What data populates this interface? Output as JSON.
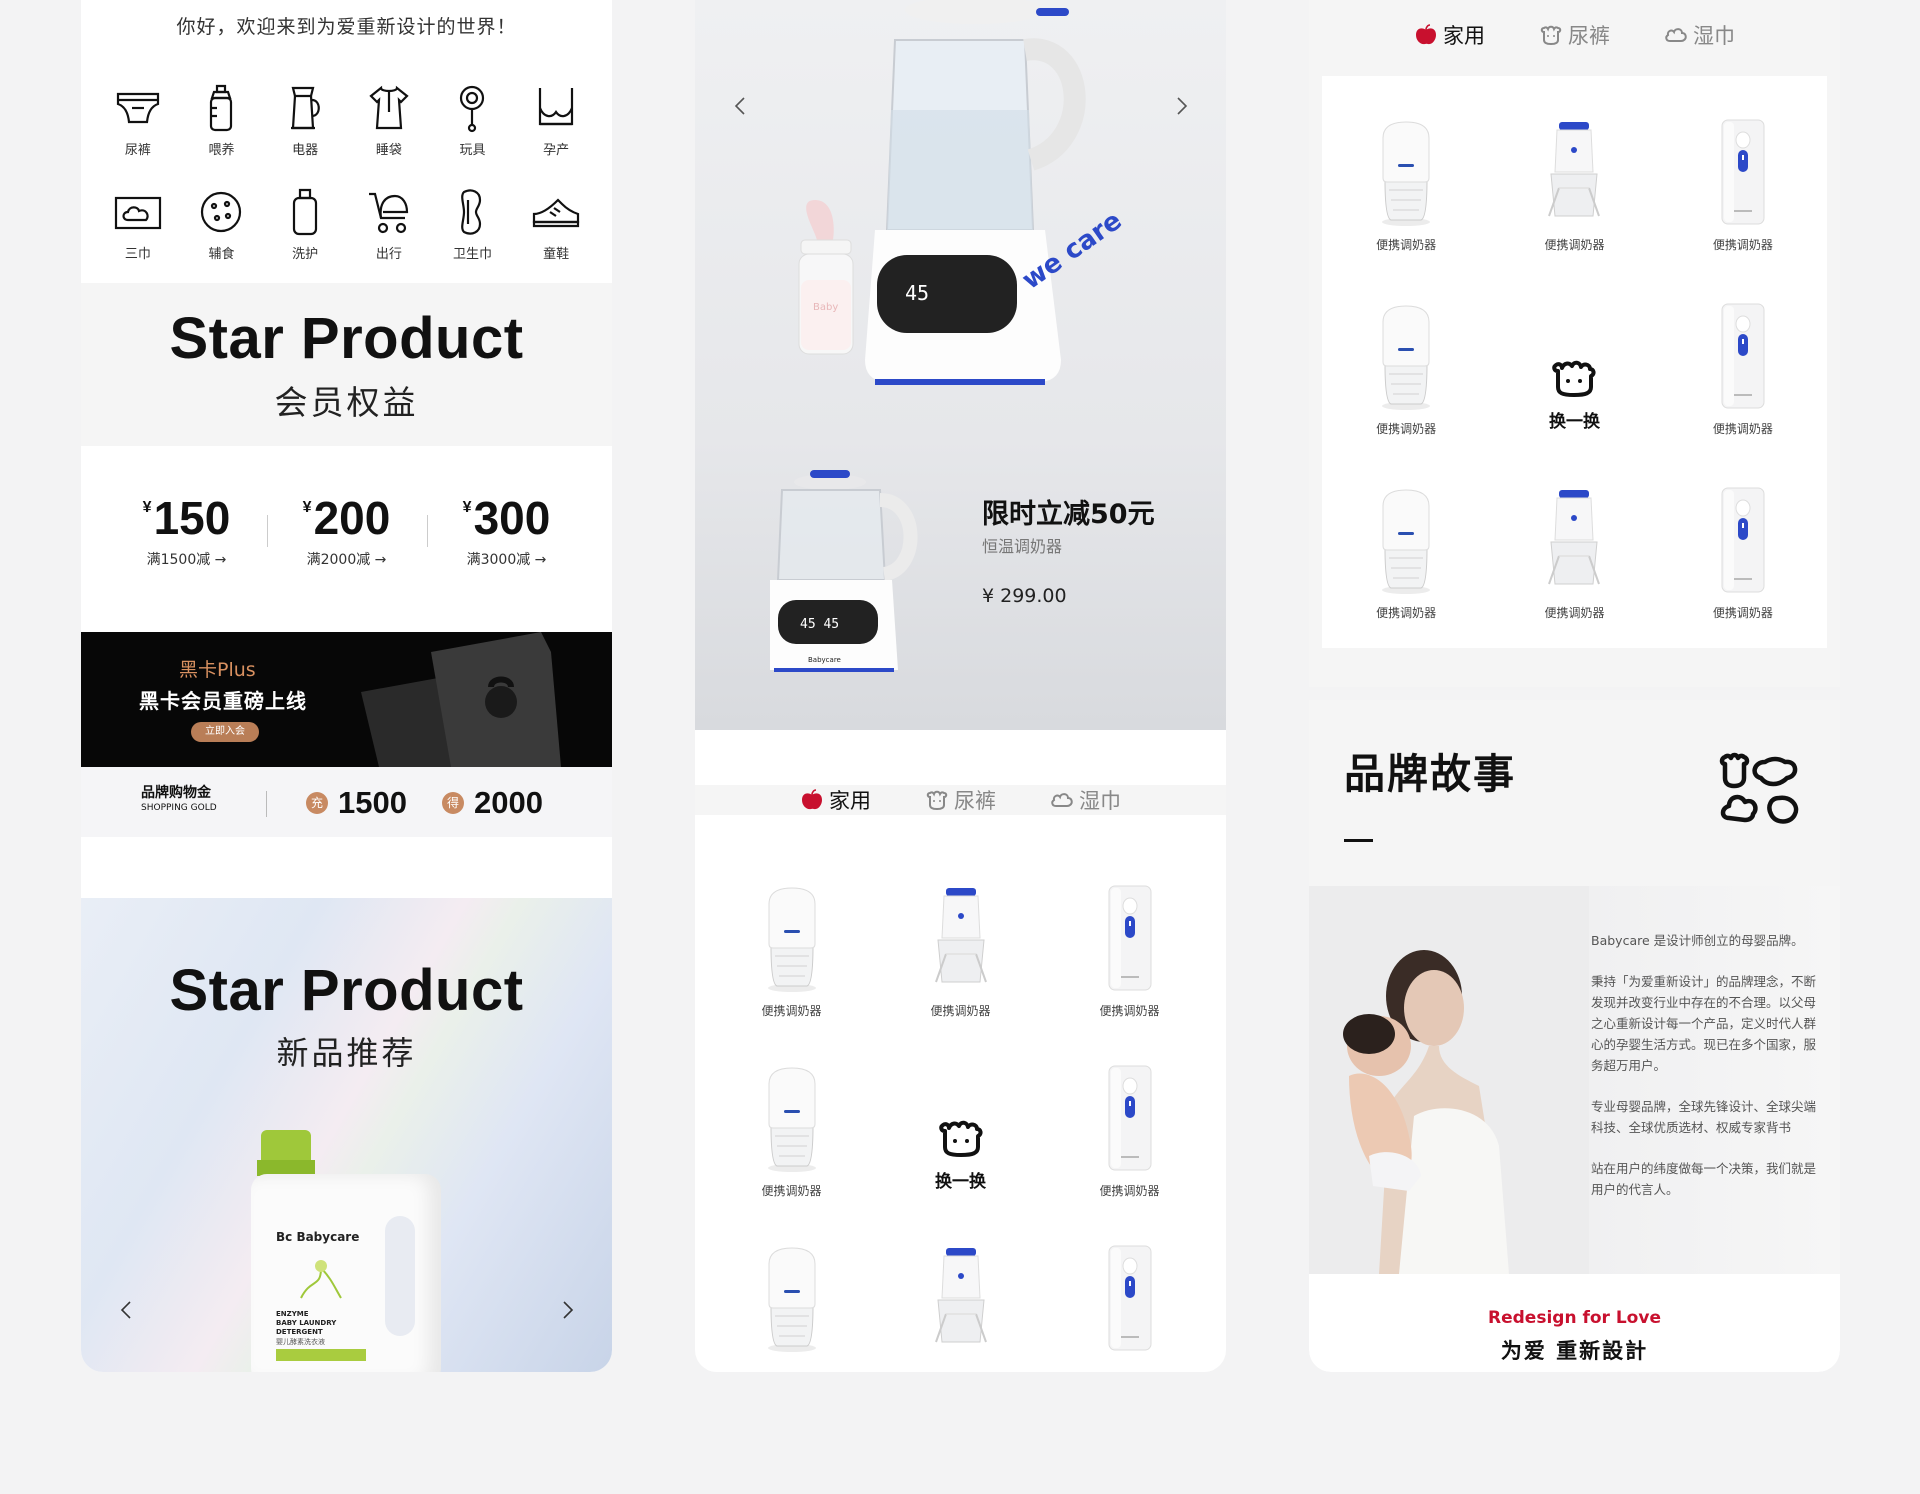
{
  "col1": {
    "greeting": "你好，欢迎来到为爱重新设计的世界！",
    "categories": [
      {
        "label": "尿裤",
        "icon": "diaper-icon"
      },
      {
        "label": "喂养",
        "icon": "baby-bottle-icon"
      },
      {
        "label": "电器",
        "icon": "kettle-icon"
      },
      {
        "label": "睡袋",
        "icon": "sleeping-bag-icon"
      },
      {
        "label": "玩具",
        "icon": "rattle-icon"
      },
      {
        "label": "孕产",
        "icon": "maternity-bra-icon"
      },
      {
        "label": "三巾",
        "icon": "towel-icon"
      },
      {
        "label": "辅食",
        "icon": "cookie-icon"
      },
      {
        "label": "洗护",
        "icon": "lotion-bottle-icon"
      },
      {
        "label": "出行",
        "icon": "stroller-icon"
      },
      {
        "label": "卫生巾",
        "icon": "sanitary-pad-icon"
      },
      {
        "label": "童鞋",
        "icon": "sneaker-icon"
      }
    ],
    "member": {
      "title": "Star Product",
      "subtitle": "会员权益"
    },
    "coupons": [
      {
        "currency": "¥",
        "amount": "150",
        "condition": "满1500减 →"
      },
      {
        "currency": "¥",
        "amount": "200",
        "condition": "满2000减 →"
      },
      {
        "currency": "¥",
        "amount": "300",
        "condition": "满3000减 →"
      }
    ],
    "black_card": {
      "tag": "黑卡Plus",
      "title": "黑卡会员重磅上线",
      "button": "立即入会"
    },
    "gold": {
      "label": "品牌购物金",
      "label_en": "SHOPPING GOLD",
      "charge_badge": "充",
      "charge": "1500",
      "get_badge": "得",
      "get": "2000"
    },
    "new_products": {
      "title": "Star Product",
      "subtitle": "新品推荐"
    },
    "detergent": {
      "brand": "Bc Babycare",
      "line1": "ENZYME",
      "line2": "BABY LAUNDRY",
      "line3": "DETERGENT",
      "line4": "婴儿酵素洗衣液"
    }
  },
  "col2": {
    "kettle_display": "45",
    "kettle_brand": "we care",
    "bottle_brand": "Baby",
    "promo": {
      "title": "限时立减50元",
      "subtitle": "恒温调奶器",
      "price": "¥ 299.00"
    },
    "small_kettle_display": "45 45",
    "small_kettle_brand": "Babycare",
    "tabs": [
      {
        "label": "家用",
        "icon": "apple-icon",
        "active": true
      },
      {
        "label": "尿裤",
        "icon": "crown-icon",
        "active": false
      },
      {
        "label": "湿巾",
        "icon": "cloud-icon",
        "active": false
      }
    ],
    "products": [
      "便携调奶器",
      "便携调奶器",
      "便携调奶器",
      "便携调奶器",
      "换一换",
      "便携调奶器",
      "",
      "",
      ""
    ]
  },
  "col3": {
    "tabs": [
      {
        "label": "家用",
        "icon": "apple-icon",
        "active": true
      },
      {
        "label": "尿裤",
        "icon": "crown-icon",
        "active": false
      },
      {
        "label": "湿巾",
        "icon": "cloud-icon",
        "active": false
      }
    ],
    "products": [
      "便携调奶器",
      "便携调奶器",
      "便携调奶器",
      "便携调奶器",
      "换一换",
      "便携调奶器",
      "便携调奶器",
      "便携调奶器",
      "便携调奶器"
    ],
    "story": {
      "title": "品牌故事",
      "paragraphs": [
        "Babycare 是设计师创立的母婴品牌。",
        "秉持「为爱重新设计」的品牌理念，不断发现并改变行业中存在的不合理。以父母之心重新设计每一个产品，定义时代人群心的孕婴生活方式。现已在多个国家，服务超万用户。",
        "专业母婴品牌，全球先锋设计、全球尖端科技、全球优质选材、权威专家背书",
        "站在用户的纬度做每一个决策，我们就是用户的代言人。"
      ],
      "tagline_en": "Redesign for Love",
      "tagline_cn": "为爱 重新設計"
    }
  },
  "colors": {
    "accent_red": "#c8102e",
    "gold_brown": "#c88a62",
    "black_card_bg": "#070707"
  }
}
